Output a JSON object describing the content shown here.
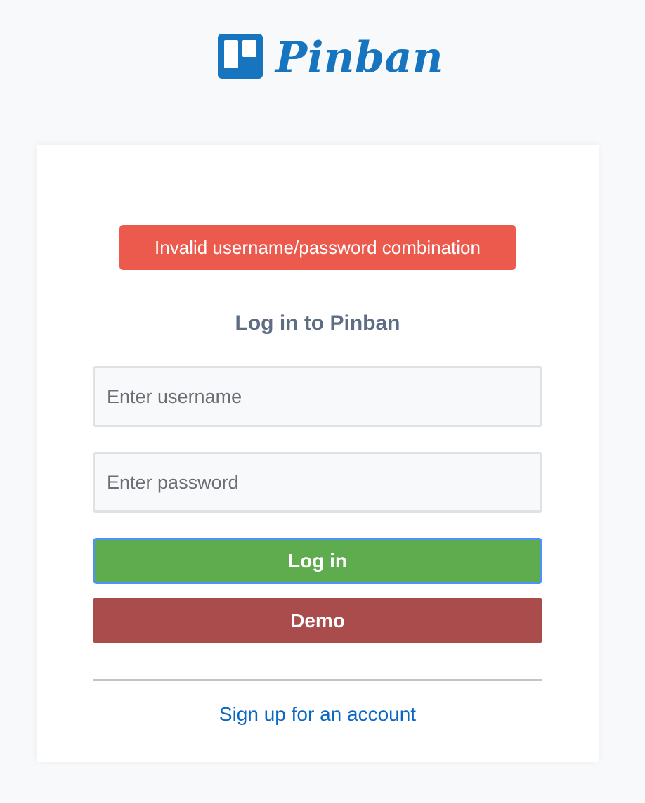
{
  "brand": {
    "name": "Pinban",
    "icon": "board-icon",
    "color": "#1675be"
  },
  "alert": {
    "message": "Invalid username/password combination",
    "color": "#eb5a4d"
  },
  "login": {
    "title": "Log in to Pinban",
    "username_placeholder": "Enter username",
    "password_placeholder": "Enter password",
    "login_label": "Log in",
    "demo_label": "Demo",
    "signup_label": "Sign up for an account"
  },
  "colors": {
    "login_button": "#5fac4f",
    "demo_button": "#aa4c4b",
    "link": "#0b67c2",
    "title": "#5e6c84"
  }
}
